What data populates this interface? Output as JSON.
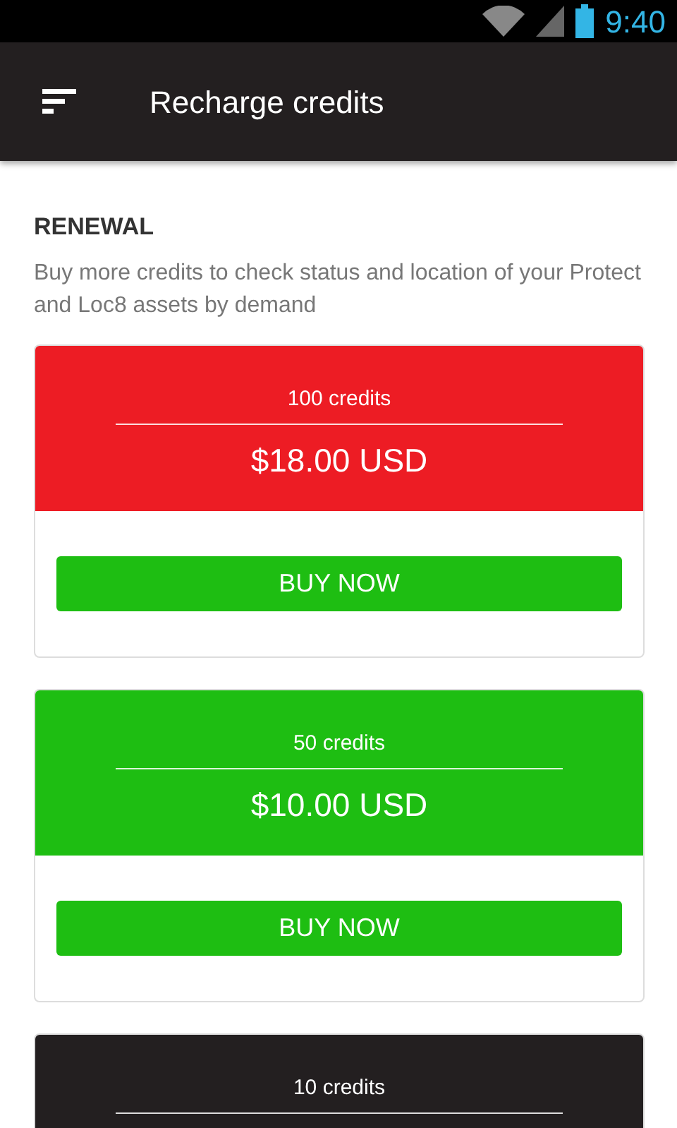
{
  "status_bar": {
    "time": "9:40"
  },
  "app_bar": {
    "title": "Recharge credits"
  },
  "section": {
    "heading": "RENEWAL",
    "description": "Buy more credits to check status and location of your Protect and Loc8 assets by demand"
  },
  "packages": [
    {
      "credits": "100 credits",
      "price": "$18.00 USD",
      "color": "#ed1c24",
      "button": "BUY NOW"
    },
    {
      "credits": "50 credits",
      "price": "$10.00 USD",
      "color": "#1ebe12",
      "button": "BUY NOW"
    },
    {
      "credits": "10 credits",
      "color": "#231f20"
    }
  ]
}
